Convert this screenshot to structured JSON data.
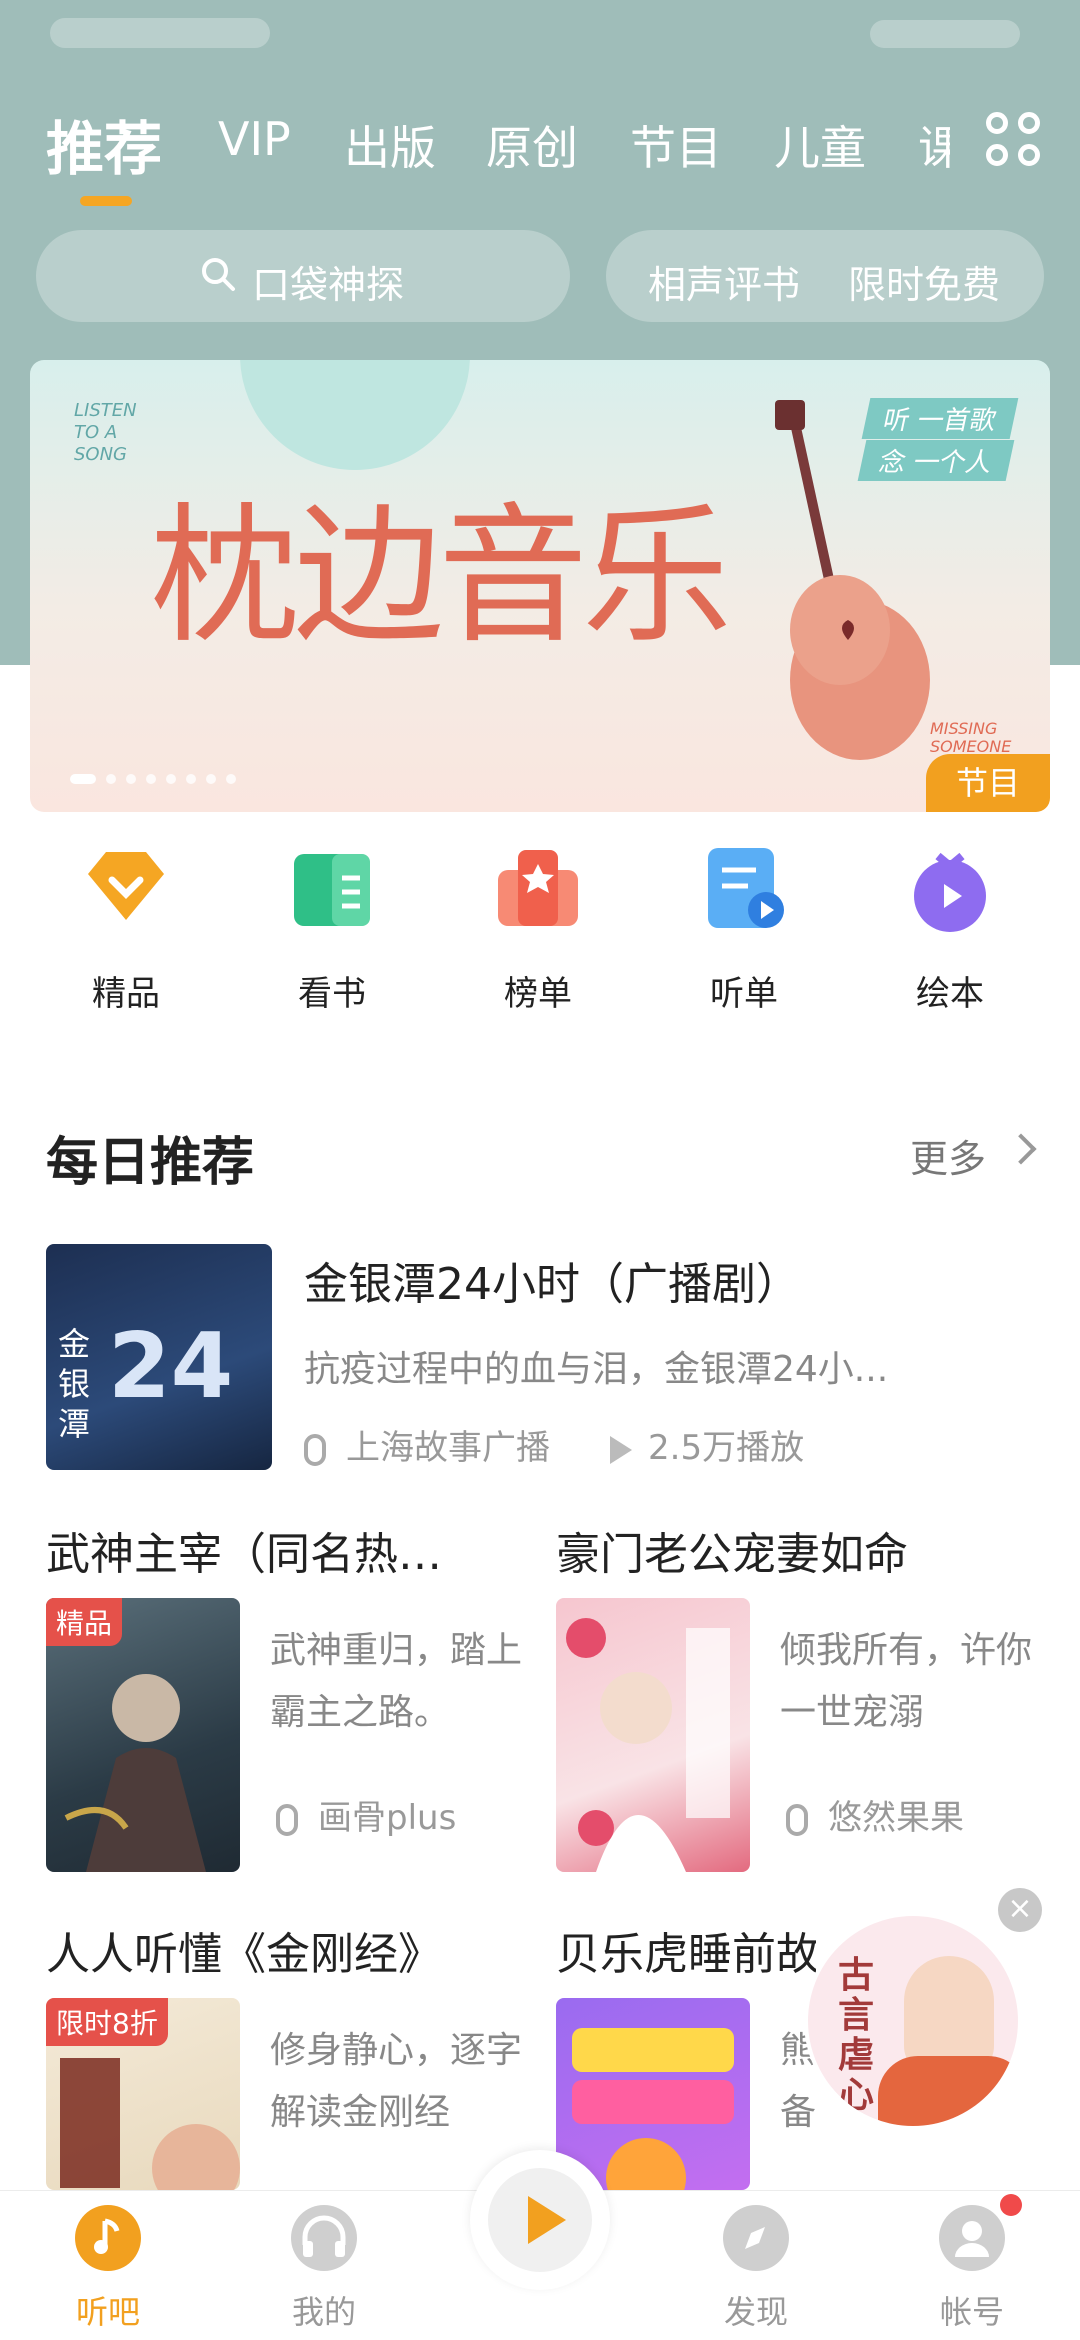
{
  "tabs": [
    "推荐",
    "VIP",
    "出版",
    "原创",
    "节目",
    "儿童",
    "课"
  ],
  "search": {
    "placeholder": "口袋神探"
  },
  "chips": [
    "相声评书",
    "限时免费"
  ],
  "banner": {
    "kicker_left": "LISTEN TO A SONG",
    "title_art": "枕边音乐",
    "tag_line1": "听  一首歌",
    "tag_line2": "念  一个人",
    "kicker_right": "MISSING SOMEONE",
    "badge": "节目"
  },
  "quick": [
    {
      "label": "精品",
      "icon": "diamond-icon",
      "color": "#f5a623"
    },
    {
      "label": "看书",
      "icon": "book-icon",
      "color": "#2fbf87"
    },
    {
      "label": "榜单",
      "icon": "ranking-icon",
      "color": "#f0604c"
    },
    {
      "label": "听单",
      "icon": "playlist-icon",
      "color": "#3a9cf0"
    },
    {
      "label": "绘本",
      "icon": "picture-book-icon",
      "color": "#8e6cf0"
    }
  ],
  "daily": {
    "title": "每日推荐",
    "more": "更多",
    "featured": {
      "title": "金银潭24小时（广播剧）",
      "desc": "抗疫过程中的血与泪，金银潭24小...",
      "author": "上海故事广播",
      "plays": "2.5万播放",
      "cover_big": "24",
      "cover_left": "金银潭"
    },
    "cards": [
      {
        "title": "武神主宰（同名热…",
        "desc": "武神重归，踏上霸主之路。",
        "author": "画骨plus",
        "badge": "精品"
      },
      {
        "title": "豪门老公宠妻如命",
        "desc": "倾我所有，许你一世宠溺",
        "author": "悠然果果",
        "badge": ""
      },
      {
        "title": "人人听懂《金刚经》",
        "desc": "修身静心，逐字解读金刚经",
        "author": "",
        "badge": "限时8折"
      },
      {
        "title": "贝乐虎睡前故事",
        "desc": "熊备",
        "author": "",
        "badge": ""
      }
    ]
  },
  "float_ad": {
    "text": "古言虐心"
  },
  "bottom_nav": [
    "听吧",
    "我的",
    "发现",
    "帐号"
  ],
  "colors": {
    "accent": "#f2a01f",
    "header": "#9fbdb9"
  }
}
